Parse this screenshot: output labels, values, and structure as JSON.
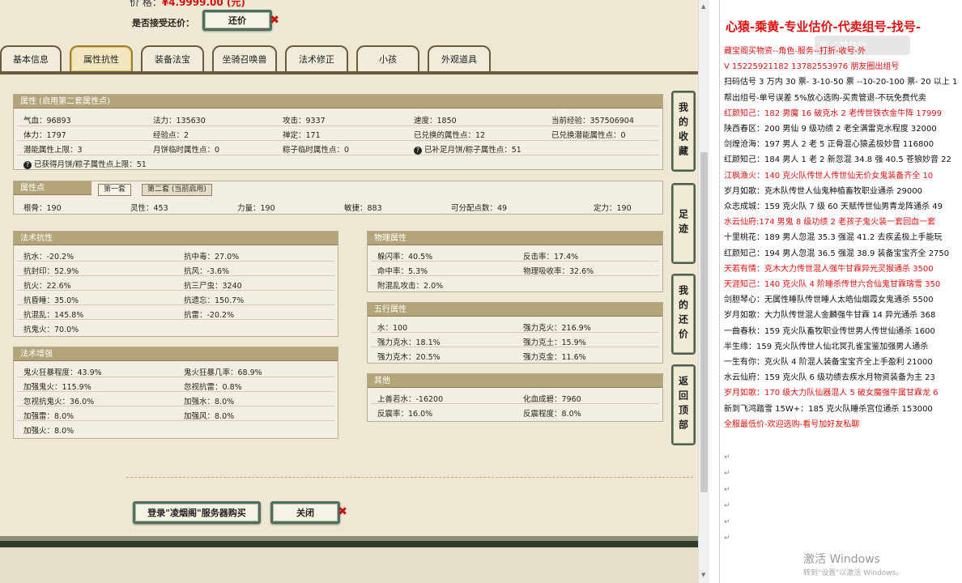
{
  "game": {
    "price_label": "价      格：",
    "price_value": "¥4.9999.00 (元)",
    "accept_counter_label": "是否接受还价：",
    "counter_button": "还价",
    "tabs": [
      "基本信息",
      "属性抗性",
      "装备法宝",
      "坐骑召唤兽",
      "法术修正",
      "小孩",
      "外观道具"
    ],
    "active_tab": "属性抗性",
    "attr_section": {
      "title": "属性 (启用第二套属性点)",
      "rows": [
        [
          "气血：96893",
          "法力：135630",
          "攻击：9337",
          "速度：1850",
          "当前经验：357506904"
        ],
        [
          "体力：1797",
          "经验点：2",
          "禅定：171",
          "已兑换的属性点：12",
          "已兑换潜能属性点：0"
        ],
        [
          "潜能属性上限：3",
          "月饼临时属性点：0",
          "粽子临时属性点：0",
          "已补足月饼/粽子属性点：51",
          ""
        ]
      ],
      "footnote": "已获得月饼/粽子属性点上限：51"
    },
    "points_section": {
      "title": "属性点",
      "subtabs": [
        "第一套",
        "第二套 (当前启用)"
      ],
      "values": [
        "根骨：190",
        "灵性：453",
        "力量：190",
        "敏捷：883",
        "可分配点数：49",
        "定力：190"
      ]
    },
    "resist_section": {
      "title": "法术抗性",
      "rows": [
        [
          "抗水：-20.2%",
          "抗中毒：27.0%"
        ],
        [
          "抗封印：52.9%",
          "抗风：-3.6%"
        ],
        [
          "抗火：22.6%",
          "抗三尸虫：3240"
        ],
        [
          "抗昏睡：35.0%",
          "抗遗忘：150.7%"
        ],
        [
          "抗混乱：145.8%",
          "抗雷：-20.2%"
        ],
        [
          "抗鬼火：70.0%",
          ""
        ]
      ]
    },
    "enhance_section": {
      "title": "法术增强",
      "rows": [
        [
          "鬼火狂暴程度：43.9%",
          "鬼火狂暴几率：68.9%"
        ],
        [
          "加强鬼火：115.9%",
          "忽视抗雷：0.8%"
        ],
        [
          "忽视抗鬼火：36.0%",
          "加强水：8.0%"
        ],
        [
          "加强雷：8.0%",
          "加强风：8.0%"
        ],
        [
          "加强火：8.0%",
          ""
        ]
      ]
    },
    "physical_section": {
      "title": "物理属性",
      "rows": [
        [
          "躲闪率：40.5%",
          "反击率：17.4%"
        ],
        [
          "命中率：5.3%",
          "物理吸收率：32.6%"
        ],
        [
          "附混乱攻击：2.0%",
          ""
        ]
      ]
    },
    "elements_section": {
      "title": "五行属性",
      "rows": [
        [
          "水：100",
          "强力克火：216.9%"
        ],
        [
          "强力克水：18.1%",
          "强力克土：15.9%"
        ],
        [
          "强力克木：20.5%",
          "强力克金：11.6%"
        ]
      ]
    },
    "other_section": {
      "title": "其他",
      "rows": [
        [
          "上善若水：-16200",
          "化血成碧：7960"
        ],
        [
          "反震率：16.0%",
          "反震程度：8.0%"
        ]
      ]
    },
    "buy_button": "登录\"凌烟阁\"服务器购买",
    "close_button": "关闭",
    "side_buttons": [
      "我的收藏",
      "足迹",
      "我的还价",
      "返回顶部"
    ]
  },
  "doc": {
    "title": "心猿-乘黄-专业估价-代卖组号-找号-",
    "lines": [
      {
        "text": "藏宝阁买物资--角色-服务--打折-收号-外",
        "color": "red"
      },
      {
        "text": "V 15225921182    13782553976  朋友圈出组号",
        "color": "red"
      },
      {
        "text": "扫码估号 3 万内 30 票- 3-10-50 票  --10-20-100 票- 20 以上 1",
        "color": "black"
      },
      {
        "text": "帮出组号-单号误差 5%放心选购-买贵管退-不玩免费代卖",
        "color": "black"
      },
      {
        "text": "红颜知己：182 男魔 16 破克水 2 老传世铁衣金牛阵 17999",
        "color": "red"
      },
      {
        "text": "陕西春区：200 男仙 9 级功绩 2 老全满雷克水程度 32000",
        "color": "black"
      },
      {
        "text": "剑煌沧海：197 男人 2 老 5 正骨混心猿孟极妙音 116800",
        "color": "black"
      },
      {
        "text": "红颜知己：184 男人 1 老 2 新忽混 34.8 强 40.5 苍狼妙音 22",
        "color": "black"
      },
      {
        "text": "江枫渔火：140 克火队传世人传世仙无价女鬼装备齐全 10",
        "color": "red"
      },
      {
        "text": "岁月如歌：克木队传世人仙鬼种植畜牧职业通杀 29000",
        "color": "black"
      },
      {
        "text": "众志成城：159 克火队 7 级 60 天赋传世仙男青龙阵通杀 49",
        "color": "black"
      },
      {
        "text": "水云仙府:174 男鬼 8 级功绩 2 老孩子鬼火装一套回血一套",
        "color": "red"
      },
      {
        "text": "十里桃花：189 男人忽混 35.3 强混 41.2 去疾孟极上手能玩",
        "color": "black"
      },
      {
        "text": "红颜知己：194 男人忽混 36.5 强混 38.9 装备宝宝齐全 2750",
        "color": "black"
      },
      {
        "text": "天若有情：克木大力传世混人强牛甘霖异光灵猴通杀 3500",
        "color": "red"
      },
      {
        "text": "天涯知己：140 克火队 4 阶睡杀传世六合仙鬼甘霖瑞雪 350",
        "color": "red"
      },
      {
        "text": "剑胆琴心：无属性睡队传世睡人太皓仙烟霞女鬼通杀 5500",
        "color": "black"
      },
      {
        "text": "岁月如歌：大力队传世混人金麟强牛甘霖 14 异光通杀 368",
        "color": "black"
      },
      {
        "text": "一曲春秋：159 克火队畜牧职业传世男人传世仙通杀 1600",
        "color": "black"
      },
      {
        "text": "半生缘：159 克火队传世人仙北冥孔雀宝鉴加强男人通杀",
        "color": "black"
      },
      {
        "text": "一生有你：克火队 4 阶混人装备宝宝齐全上手盈利 21000",
        "color": "black"
      },
      {
        "text": "水云仙府：159 克火队 6 级功绩去疾水月物资装备为主 23",
        "color": "black"
      },
      {
        "text": "岁月如歌：170 级大力队仙器混人 5 破女魔强牛属甘霖龙 6",
        "color": "red"
      },
      {
        "text": "新到飞鸿踏雪 15W+：185 克火队睡杀宫位通杀 153000",
        "color": "black"
      },
      {
        "text": "全服最低价-欢迎选购-看号加好友私聊",
        "color": "red"
      }
    ],
    "overlay_text": "号 心猿估计",
    "watermark_title": "激活 Windows",
    "watermark_sub": "转到\"设置\"以激活 Windows。"
  }
}
